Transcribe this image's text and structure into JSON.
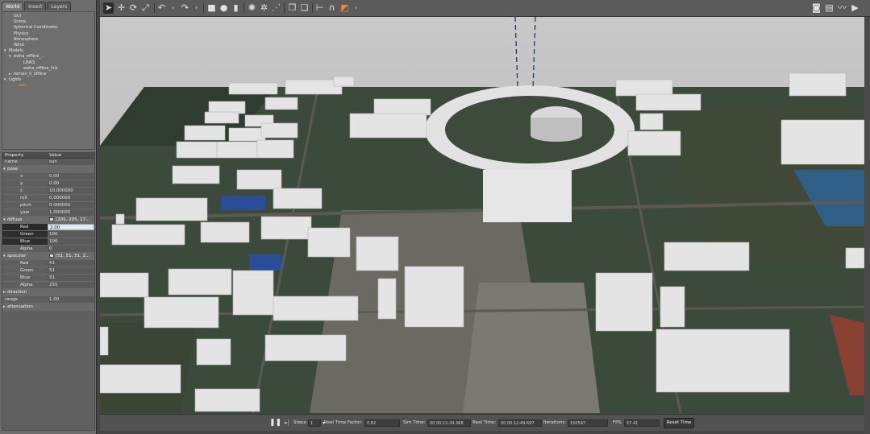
{
  "left_panel": {
    "tabs": [
      "World",
      "Insert",
      "Layers"
    ],
    "tree": [
      {
        "label": "GUI",
        "indent": 1,
        "arrow": ""
      },
      {
        "label": "Scene",
        "indent": 1,
        "arrow": ""
      },
      {
        "label": "Spherical Coordinates",
        "indent": 1,
        "arrow": ""
      },
      {
        "label": "Physics",
        "indent": 1,
        "arrow": ""
      },
      {
        "label": "Atmosphere",
        "indent": 1,
        "arrow": ""
      },
      {
        "label": "Wind",
        "indent": 1,
        "arrow": ""
      },
      {
        "label": "Models",
        "indent": 0,
        "arrow": "▾"
      },
      {
        "label": "ewha_offline_...",
        "indent": 1,
        "arrow": "▾"
      },
      {
        "label": "LINKS",
        "indent": 3,
        "arrow": ""
      },
      {
        "label": "ewha_offline_link",
        "indent": 3,
        "arrow": ""
      },
      {
        "label": "terrain_0_offline",
        "indent": 1,
        "arrow": "▸"
      },
      {
        "label": "Lights",
        "indent": 0,
        "arrow": "▾"
      },
      {
        "label": "sun",
        "indent": 2,
        "arrow": "",
        "orange": true
      }
    ]
  },
  "properties": {
    "header": {
      "property": "Property",
      "value": "Value"
    },
    "rows": [
      {
        "key": "name",
        "value": "sun",
        "type": "field"
      },
      {
        "key": "pose",
        "value": "",
        "type": "section",
        "caret": "▾"
      },
      {
        "key": "x",
        "value": "0.00",
        "type": "sub"
      },
      {
        "key": "y",
        "value": "0.00",
        "type": "sub"
      },
      {
        "key": "z",
        "value": "10.000000",
        "type": "sub"
      },
      {
        "key": "roll",
        "value": "0.000000",
        "type": "sub"
      },
      {
        "key": "pitch",
        "value": "0.000000",
        "type": "sub"
      },
      {
        "key": "yaw",
        "value": "1.000000",
        "type": "sub"
      },
      {
        "key": "diffuse",
        "value": "[205, 205, 17...",
        "type": "section-swatch",
        "caret": "▾"
      },
      {
        "key": "Red",
        "value": "2.00",
        "type": "editing"
      },
      {
        "key": "Green",
        "value": "100",
        "type": "sub-dark"
      },
      {
        "key": "Blue",
        "value": "100",
        "type": "sub-dark"
      },
      {
        "key": "Alpha",
        "value": "0",
        "type": "sub"
      },
      {
        "key": "specular",
        "value": "[51, 51, 51, 2...",
        "type": "section-swatch",
        "caret": "▾"
      },
      {
        "key": "Red",
        "value": "51",
        "type": "sub"
      },
      {
        "key": "Green",
        "value": "51",
        "type": "sub"
      },
      {
        "key": "Blue",
        "value": "51",
        "type": "sub"
      },
      {
        "key": "Alpha",
        "value": "255",
        "type": "sub"
      },
      {
        "key": "direction",
        "value": "",
        "type": "section",
        "caret": "▸"
      },
      {
        "key": "range",
        "value": "1.00",
        "type": "field"
      },
      {
        "key": "attenuation",
        "value": "",
        "type": "section",
        "caret": "▸"
      }
    ]
  },
  "toolbar": {
    "icons": [
      "select-arrow-icon",
      "translate-icon",
      "rotate-icon",
      "scale-icon",
      "undo-icon",
      "redo-icon",
      "box-icon",
      "sphere-icon",
      "cylinder-icon",
      "point-light-icon",
      "spot-light-icon",
      "directional-light-icon",
      "copy-icon",
      "paste-icon",
      "align-icon",
      "snap-icon",
      "change-view-icon",
      "screenshot-icon",
      "log-icon",
      "plot-icon",
      "video-icon"
    ]
  },
  "bottom_bar": {
    "steps_label": "Steps:",
    "steps_value": "1",
    "rtf_label": "Real Time Factor:",
    "rtf_value": "0.82",
    "sim_time_label": "Sim Time:",
    "sim_time_value": "00 00:12:34.368",
    "real_time_label": "Real Time:",
    "real_time_value": "00 00:12:49.697",
    "iterations_label": "Iterations:",
    "iterations_value": "150597",
    "fps_label": "FPS:",
    "fps_value": "57.41",
    "reset_label": "Reset Time"
  }
}
